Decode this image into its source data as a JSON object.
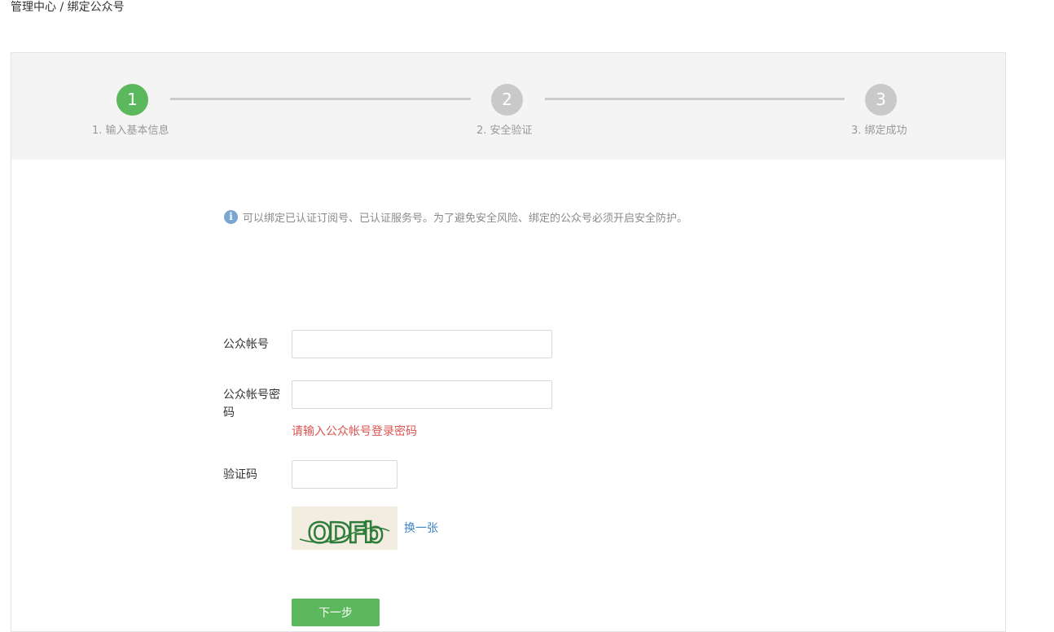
{
  "breadcrumb": "管理中心 / 绑定公众号",
  "steps": [
    {
      "number": "1",
      "label": "1. 输入基本信息",
      "state": "active"
    },
    {
      "number": "2",
      "label": "2. 安全验证",
      "state": "inactive"
    },
    {
      "number": "3",
      "label": "3. 绑定成功",
      "state": "inactive"
    }
  ],
  "notice": {
    "icon": "info-icon",
    "icon_glyph": "i",
    "text": "可以绑定已认证订阅号、已认证服务号。为了避免安全风险、绑定的公众号必须开启安全防护。"
  },
  "form": {
    "account_label": "公众帐号",
    "account_value": "",
    "password_label_line1": "公众帐号密",
    "password_label_line2": "码",
    "password_value": "",
    "password_error": "请输入公众帐号登录密码",
    "captcha_label": "验证码",
    "captcha_value": "",
    "captcha_image_text": "ODFb",
    "refresh_label": "换一张",
    "next_label": "下一步"
  },
  "colors": {
    "accent_green": "#5cb85c",
    "inactive_step": "#c9c9c9",
    "error_red": "#d9534f",
    "link_blue": "#3d84c6",
    "info_blue": "#7aa7d2"
  }
}
